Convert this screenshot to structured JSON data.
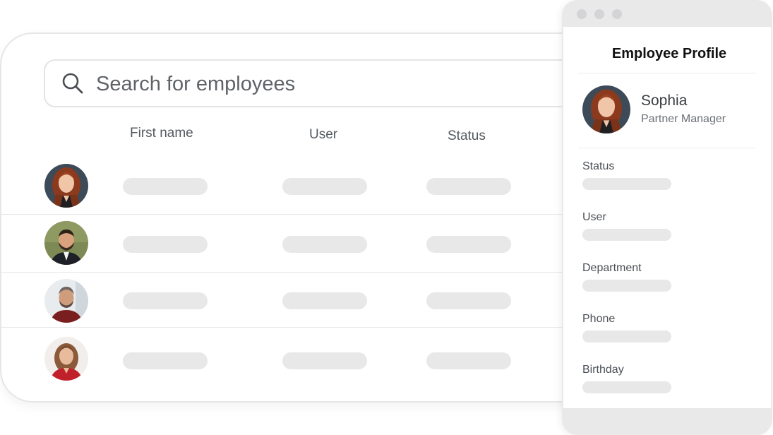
{
  "search": {
    "placeholder": "Search for employees"
  },
  "table": {
    "columns": [
      "First name",
      "User",
      "Status"
    ],
    "rows": [
      {
        "avatar": "woman-red-hair-avatar"
      },
      {
        "avatar": "man-beard-avatar"
      },
      {
        "avatar": "man-gray-hair-avatar"
      },
      {
        "avatar": "woman-red-top-avatar"
      }
    ]
  },
  "profile": {
    "title": "Employee Profile",
    "name": "Sophia",
    "role": "Partner Manager",
    "fields": [
      "Status",
      "User",
      "Department",
      "Phone",
      "Birthday"
    ]
  },
  "colors": {
    "placeholder_pill": "#e8e8e8",
    "window_chrome": "#e9e9ea",
    "border": "#e6e6e6"
  }
}
